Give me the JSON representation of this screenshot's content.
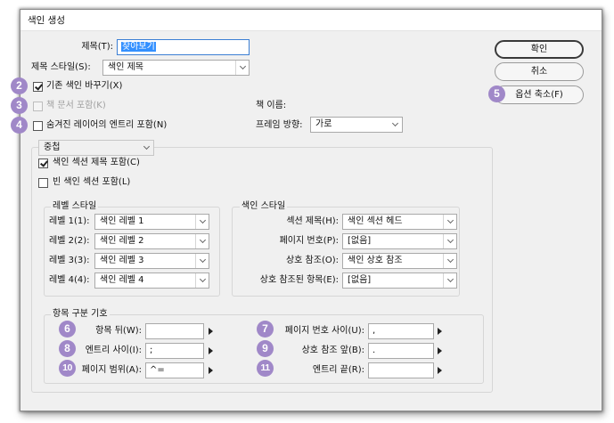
{
  "window": {
    "title": "색인 생성"
  },
  "form": {
    "title_label": "제목(T):",
    "title_value": "찾아보기",
    "title_style_label": "제목 스타일(S):",
    "title_style_value": "색인 제목",
    "replace_existing_label": "기존 색인 바꾸기(X)",
    "include_book_docs_label": "책 문서 포함(K)",
    "include_hidden_layers_label": "숨겨진 레이어의 엔트리 포함(N)",
    "book_name_label": "책 이름:",
    "frame_direction_label": "프레임 방향:",
    "frame_direction_value": "가로",
    "format_value": "중첩",
    "include_section_headings_label": "색인 섹션 제목 포함(C)",
    "include_empty_sections_label": "빈 색인 섹션 포함(L)"
  },
  "buttons": {
    "ok": "확인",
    "cancel": "취소",
    "fewer_options": "옵션 축소(F)"
  },
  "level_style": {
    "title": "레벨 스타일",
    "rows": [
      {
        "label": "레벨 1(1):",
        "value": "색인 레벨 1"
      },
      {
        "label": "레벨 2(2):",
        "value": "색인 레벨 2"
      },
      {
        "label": "레벨 3(3):",
        "value": "색인 레벨 3"
      },
      {
        "label": "레벨 4(4):",
        "value": "색인 레벨 4"
      }
    ]
  },
  "index_style": {
    "title": "색인 스타일",
    "rows": [
      {
        "label": "섹션 제목(H):",
        "value": "색인 섹션 헤드"
      },
      {
        "label": "페이지 번호(P):",
        "value": "[없음]"
      },
      {
        "label": "상호 참조(O):",
        "value": "색인 상호 참조"
      },
      {
        "label": "상호 참조된 항목(E):",
        "value": "[없음]"
      }
    ]
  },
  "separators": {
    "title": "항목 구분 기호",
    "following_topic_label": "항목 뒤(W):",
    "following_topic_value": "",
    "between_entries_label": "엔트리 사이(I):",
    "between_entries_value": ";",
    "page_range_label": "페이지 범위(A):",
    "page_range_value": "^=",
    "between_page_numbers_label": "페이지 번호 사이(U):",
    "between_page_numbers_value": ",",
    "before_cross_ref_label": "상호 참조 앞(B):",
    "before_cross_ref_value": ".",
    "entry_end_label": "엔트리 끝(R):",
    "entry_end_value": ""
  },
  "badges": [
    "2",
    "3",
    "4",
    "5",
    "6",
    "7",
    "8",
    "9",
    "10",
    "11"
  ],
  "colors": {
    "badge": "#a088c8",
    "selection": "#3390ff"
  }
}
